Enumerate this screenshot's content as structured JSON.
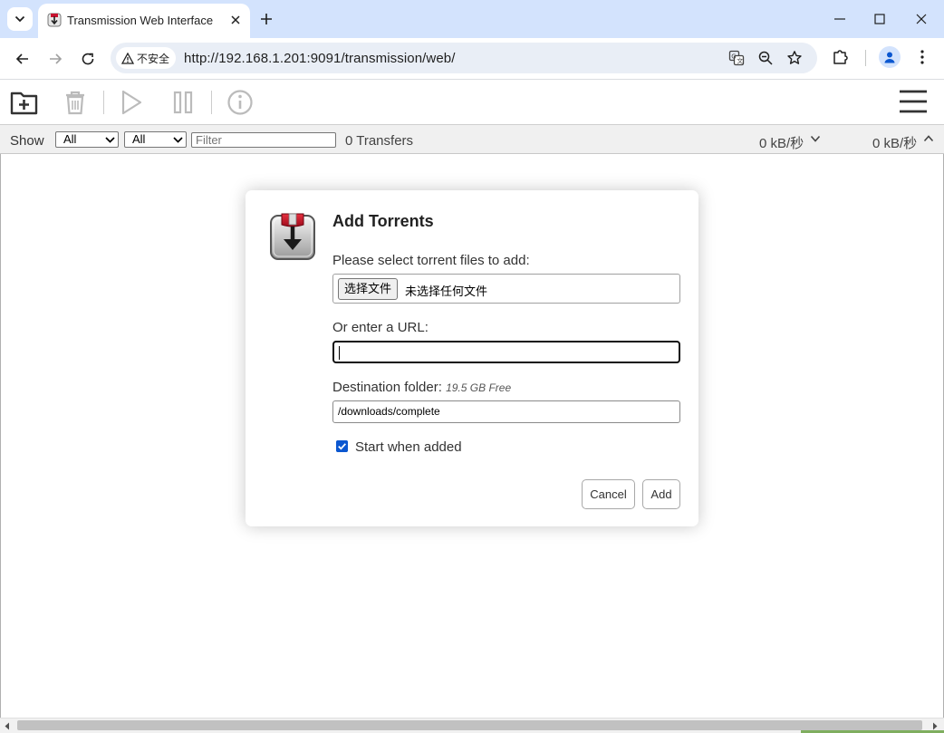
{
  "browser": {
    "tab_title": "Transmission Web Interface",
    "security_label": "不安全",
    "url": "http://192.168.1.201:9091/transmission/web/"
  },
  "toolbar": {
    "icons": [
      "open-torrent-icon",
      "remove-icon",
      "start-icon",
      "pause-icon",
      "info-icon",
      "hamburger-menu-icon"
    ]
  },
  "filterbar": {
    "show_label": "Show",
    "state_filter": "All",
    "tracker_filter": "All",
    "filter_placeholder": "Filter",
    "transfers": "0 Transfers",
    "download_speed": "0 kB/秒",
    "upload_speed": "0 kB/秒"
  },
  "dialog": {
    "title": "Add Torrents",
    "files_label": "Please select torrent files to add:",
    "file_button": "选择文件",
    "file_status": "未选择任何文件",
    "url_label": "Or enter a URL:",
    "url_value": "",
    "destination_label": "Destination folder:",
    "free_space": "19.5 GB Free",
    "destination_value": "/downloads/complete",
    "start_when_added_label": "Start when added",
    "start_when_added_checked": true,
    "cancel_label": "Cancel",
    "add_label": "Add"
  },
  "colors": {
    "tabstrip": "#d3e3fd",
    "accent": "#0b57d0",
    "logo_red": "#c8102e"
  }
}
